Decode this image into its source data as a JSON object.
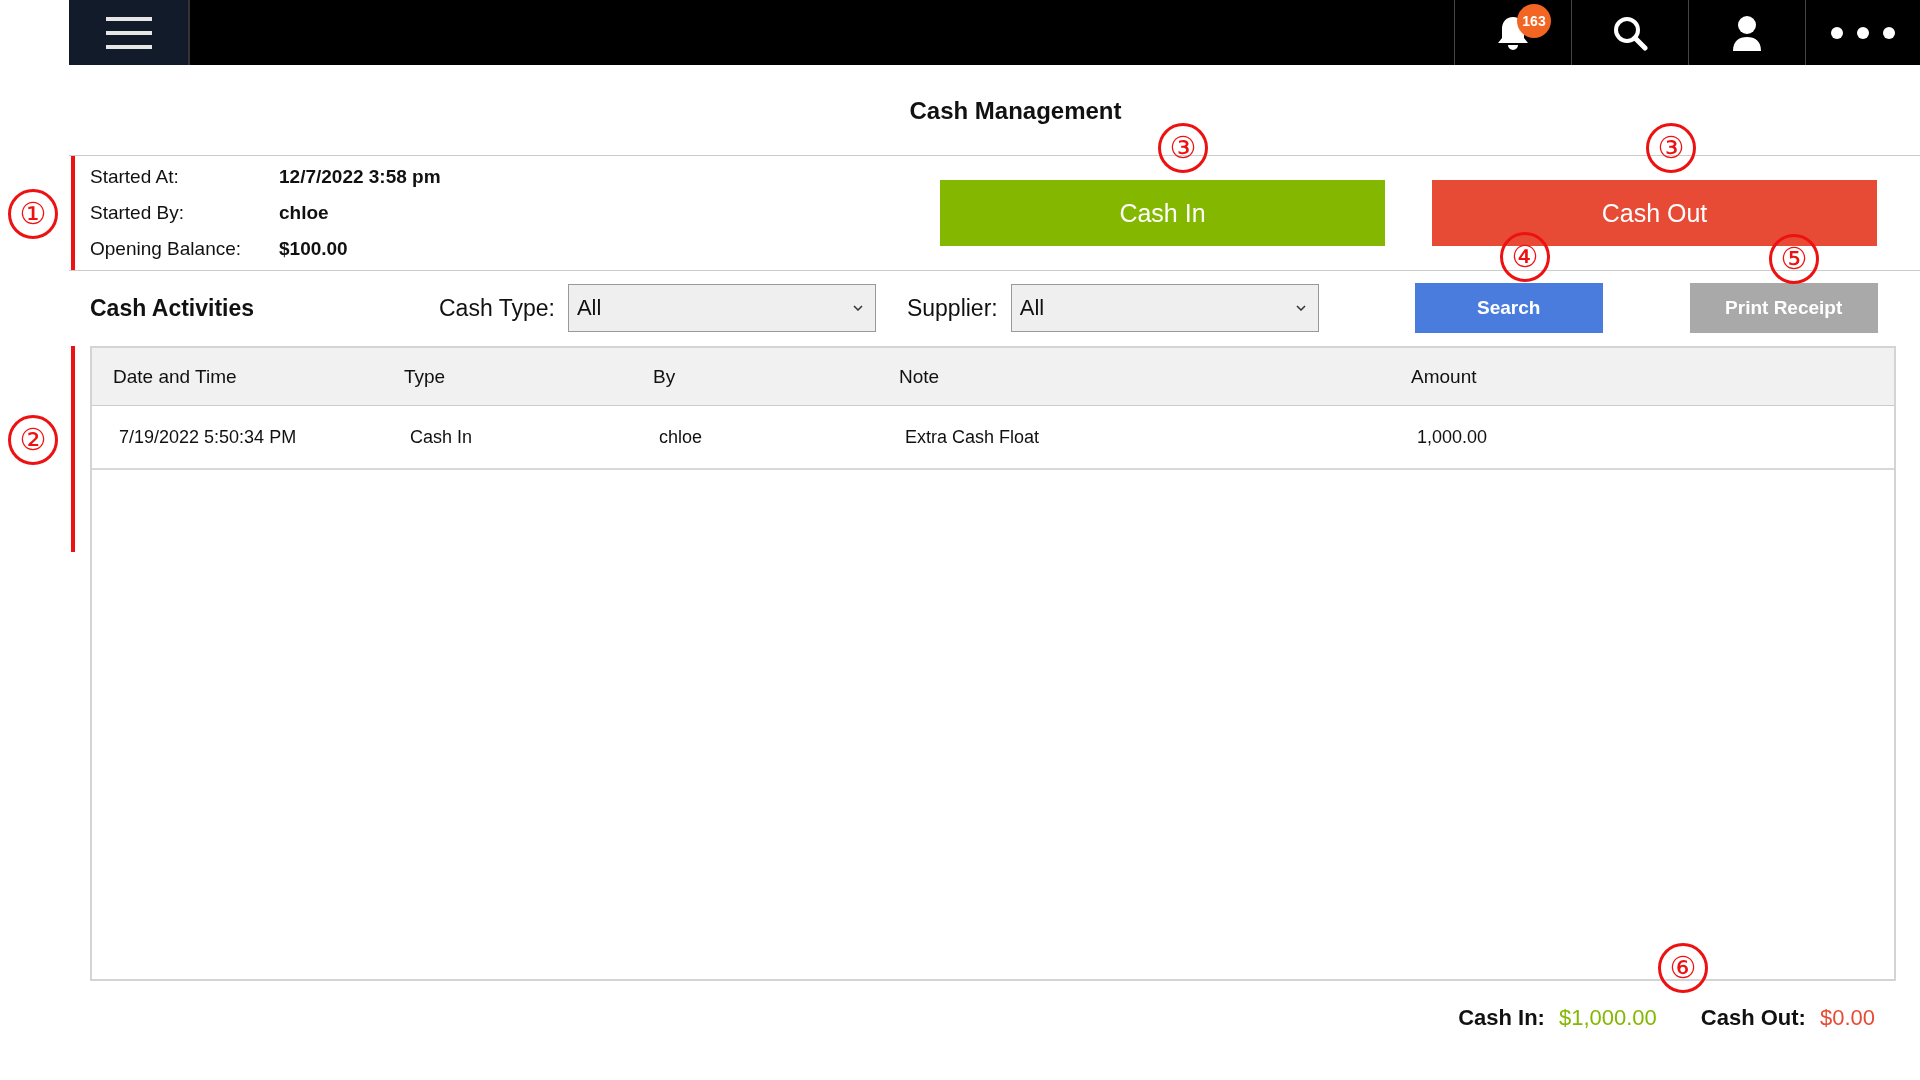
{
  "topbar": {
    "notification_count": "163"
  },
  "title": "Cash Management",
  "session": [
    {
      "label": "Started At:",
      "value": "12/7/2022 3:58 pm"
    },
    {
      "label": "Started By:",
      "value": "chloe"
    },
    {
      "label": "Opening Balance:",
      "value": "$100.00"
    }
  ],
  "actions": [
    {
      "kind": "cash_in",
      "label": "Cash In"
    },
    {
      "kind": "cash_out",
      "label": "Cash Out"
    }
  ],
  "activities": {
    "title": "Cash Activities",
    "filters": [
      {
        "label": "Cash Type:",
        "value": "All"
      },
      {
        "label": "Supplier:",
        "value": "All"
      }
    ],
    "search_button": {
      "label": "Search"
    },
    "print_button": {
      "label": "Print Receipt",
      "disabled": true
    }
  },
  "table": {
    "columns": [
      "Date and Time",
      "Type",
      "By",
      "Note",
      "Amount"
    ],
    "rows": [
      [
        "7/19/2022 5:50:34 PM",
        "Cash In",
        "chloe",
        "Extra Cash Float",
        "1,000.00"
      ]
    ]
  },
  "totals": [
    {
      "kind": "in",
      "label": "Cash In:",
      "value": "$1,000.00"
    },
    {
      "kind": "out",
      "label": "Cash Out:",
      "value": "$0.00"
    }
  ],
  "annotations": [
    "①",
    "②",
    "③",
    "③",
    "④",
    "⑤",
    "⑥"
  ]
}
